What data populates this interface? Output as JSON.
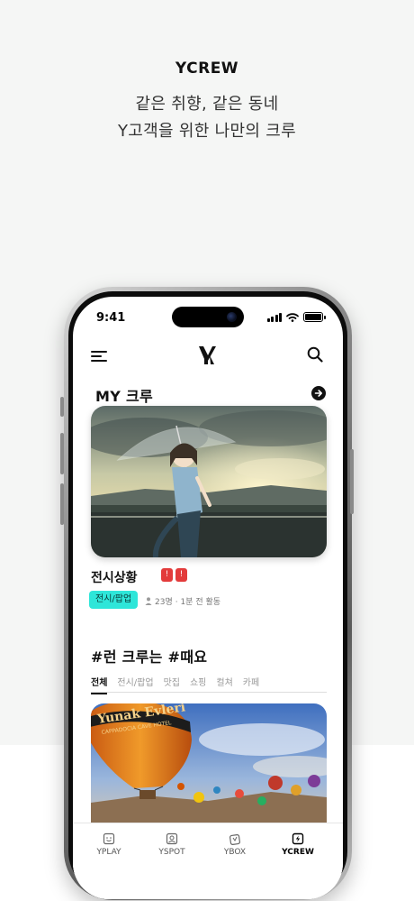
{
  "promo": {
    "brand": "YCREW",
    "line1": "같은 취향, 같은 동네",
    "line2": "Y고객을 위한 나만의 크루"
  },
  "status_bar": {
    "time": "9:41"
  },
  "header": {
    "logo": "Y",
    "menu_icon": "menu-icon",
    "search_icon": "search-icon"
  },
  "my_crew": {
    "title": "MY 크루",
    "card": {
      "name": "전시상황",
      "category": "전시/팝업",
      "members": "23명",
      "activity": "· 1분 전 활동"
    }
  },
  "recommend": {
    "title": "#런 크루는 #때요",
    "tabs": [
      "전체",
      "전시/팝업",
      "맛집",
      "쇼핑",
      "컬쳐",
      "카페"
    ],
    "active_tab": "전체",
    "balloon_text": "Yunak Evleri CAPPADOCIA CAVE HOTEL"
  },
  "nav": {
    "items": [
      {
        "label": "YPLAY",
        "icon": "smile-box-icon"
      },
      {
        "label": "YSPOT",
        "icon": "photo-box-icon"
      },
      {
        "label": "YBOX",
        "icon": "gift-box-icon"
      },
      {
        "label": "YCREW",
        "icon": "bolt-box-icon"
      }
    ],
    "active": "YCREW"
  },
  "colors": {
    "accent_chip": "#2ee6d9",
    "badge": "#e33b3b",
    "text": "#111111"
  }
}
